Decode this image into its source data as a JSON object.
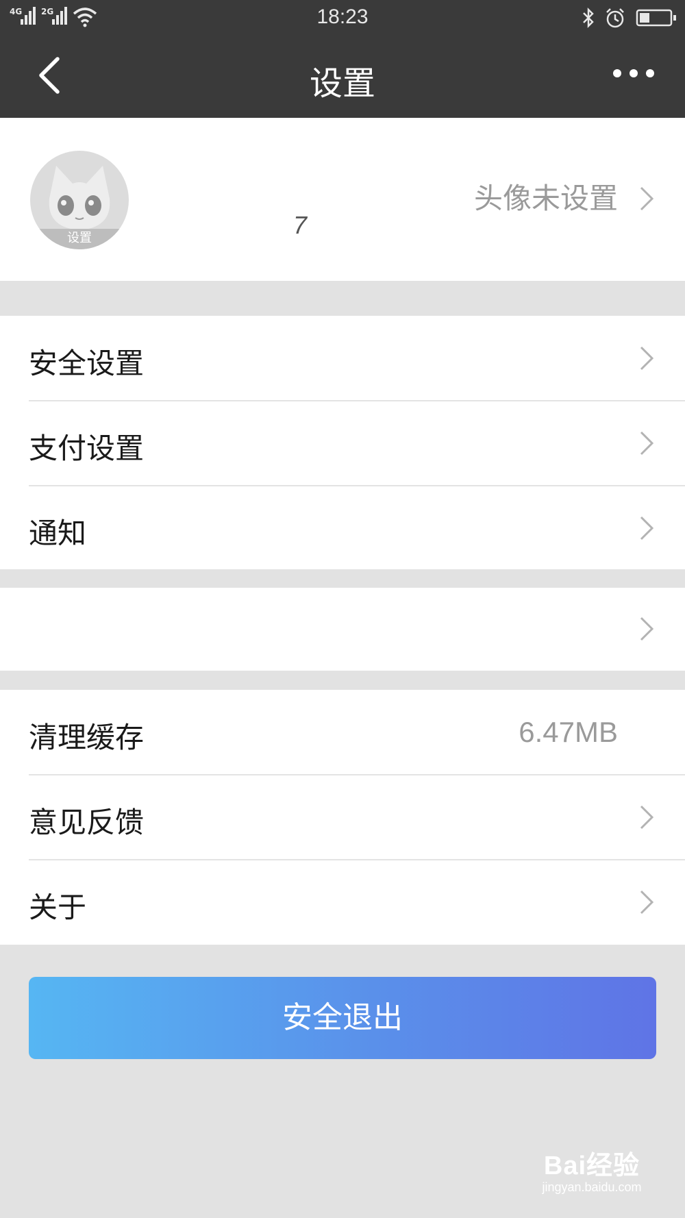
{
  "status_bar": {
    "signal_1": "4G",
    "signal_2": "2G",
    "time": "18:23"
  },
  "nav": {
    "title": "设置"
  },
  "profile": {
    "avatar_tag": "设置",
    "name": "7",
    "status": "头像未设置"
  },
  "menu_group_1": {
    "items": [
      {
        "label": "安全设置"
      },
      {
        "label": "支付设置"
      },
      {
        "label": "通知"
      }
    ]
  },
  "menu_group_3": {
    "clear_cache_label": "清理缓存",
    "cache_size": "6.47MB",
    "feedback_label": "意见反馈",
    "about_label": "关于"
  },
  "logout_label": "安全退出",
  "watermark": {
    "brand": "Bai经验",
    "site": "jingyan.baidu.com"
  }
}
